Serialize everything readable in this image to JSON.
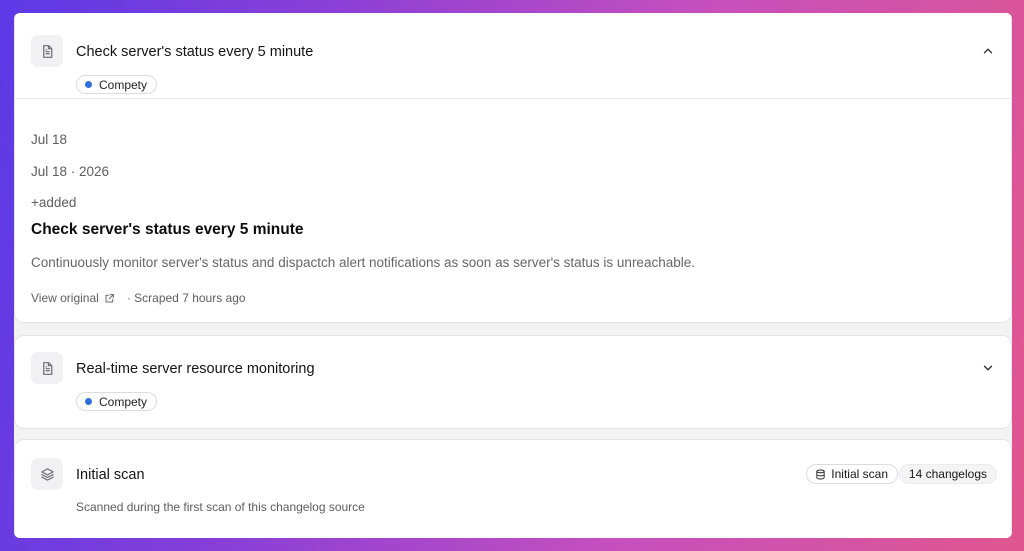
{
  "colors": {
    "accent_dot": "#2f6fdc",
    "text_primary": "#141414",
    "text_muted": "#5d5d63"
  },
  "items": [
    {
      "icon": "document-icon",
      "title": "Check server's status every 5 minute",
      "tag": "Compety",
      "expanded": true,
      "toggle_icon": "chevron-up-icon",
      "detail": {
        "date_short": "Jul 18",
        "date_full": "Jul 18 · 2026",
        "change_type": "+added",
        "heading": "Check server's status every 5 minute",
        "description": "Continuously monitor server's status and dispactch alert notifications as soon as server's status is unreachable.",
        "view_original_label": "View original",
        "scraped_label": "· Scraped 7 hours ago"
      }
    },
    {
      "icon": "document-icon",
      "title": "Real-time server resource monitoring",
      "tag": "Compety",
      "expanded": false,
      "toggle_icon": "chevron-down-icon"
    }
  ],
  "initial_scan": {
    "icon": "layers-icon",
    "title": "Initial scan",
    "subtitle": "Scanned during the first scan of this changelog source",
    "badge_label": "Initial scan",
    "badge_icon": "database-icon",
    "count_label": "14 changelogs"
  }
}
